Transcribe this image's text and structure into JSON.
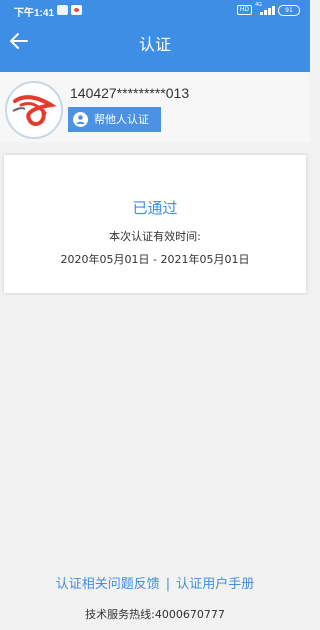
{
  "status_bar": {
    "time": "下午1:41",
    "network": "4G",
    "battery": "91"
  },
  "header": {
    "title": "认证"
  },
  "profile": {
    "id_number": "140427*********013",
    "help_button_label": "帮他人认证"
  },
  "card": {
    "status": "已通过",
    "valid_label": "本次认证有效时间:",
    "valid_range": "2020年05月01日 - 2021年05月01日"
  },
  "footer": {
    "feedback_link": "认证相关问题反馈",
    "separator": "|",
    "manual_link": "认证用户手册",
    "hotline": "技术服务热线:4000670777"
  },
  "colors": {
    "brand": "#3f8ee6",
    "status_text": "#3f8ee6"
  }
}
